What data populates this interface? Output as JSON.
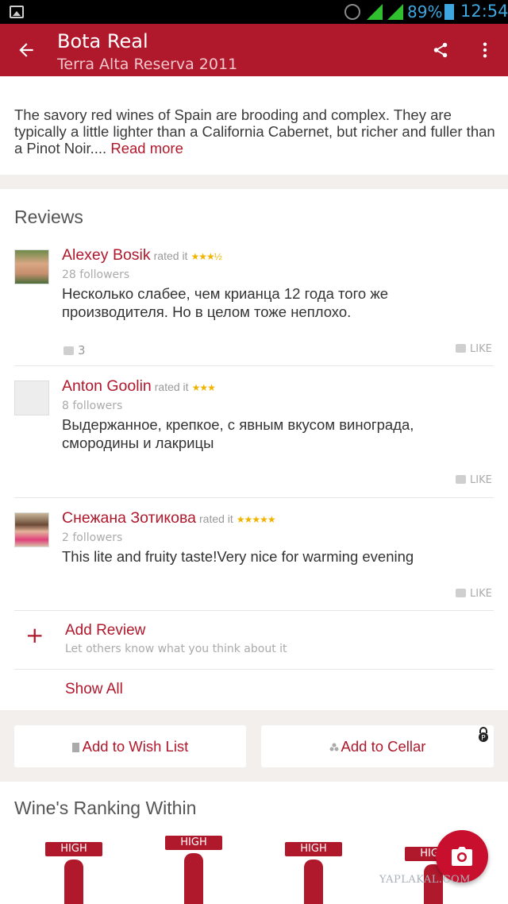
{
  "status_bar": {
    "battery_percent": "89%",
    "time": "12:54",
    "icons": [
      "image-icon",
      "alarm-icon",
      "signal-icon",
      "h-signal-icon",
      "battery-icon"
    ]
  },
  "toolbar": {
    "title": "Bota Real",
    "subtitle": "Terra Alta Reserva 2011",
    "icons": [
      "back-arrow-icon",
      "share-icon",
      "more-vert-icon"
    ]
  },
  "description": {
    "text": "The savory red wines of Spain are brooding and complex. They are typically a little lighter than a California Cabernet, but richer and fuller than a Pinot Noir....",
    "read_more": "Read more"
  },
  "reviews": {
    "title": "Reviews",
    "items": [
      {
        "name": "Alexey Bosik",
        "rated_label": "rated it",
        "stars": "★★★½",
        "rating": 3.5,
        "followers": "28 followers",
        "text": "Несколько слабее, чем крианца 12 года того же производителя. Но в целом тоже неплохо.",
        "like_count": "3",
        "like_label": "LIKE"
      },
      {
        "name": "Anton Goolin",
        "rated_label": "rated it",
        "stars": "★★★",
        "rating": 3,
        "followers": "8 followers",
        "text": "Выдержанное, крепкое, с явным вкусом винограда, смородины и лакрицы",
        "like_count": "",
        "like_label": "LIKE"
      },
      {
        "name": "Снежана Зотикова",
        "rated_label": "rated it",
        "stars": "★★★★★",
        "rating": 5,
        "followers": "2 followers",
        "text": "This lite and fruity taste!Very nice for warming evening",
        "like_count": "",
        "like_label": "LIKE"
      }
    ],
    "add_review": {
      "plus": "+",
      "label": "Add Review",
      "sub": "Let others know what you think about it"
    },
    "show_all": "Show All"
  },
  "actions": {
    "wish_list": "Add to Wish List",
    "cellar": "Add to Cellar"
  },
  "ranking": {
    "title": "Wine's Ranking Within",
    "tags": [
      "HIGH",
      "HIGH",
      "HIGH",
      "HIGH"
    ]
  },
  "watermark": "YAPLAKAL.COM",
  "colors": {
    "brand": "#b0182c",
    "star": "#f0b400",
    "fab": "#c8102e"
  }
}
